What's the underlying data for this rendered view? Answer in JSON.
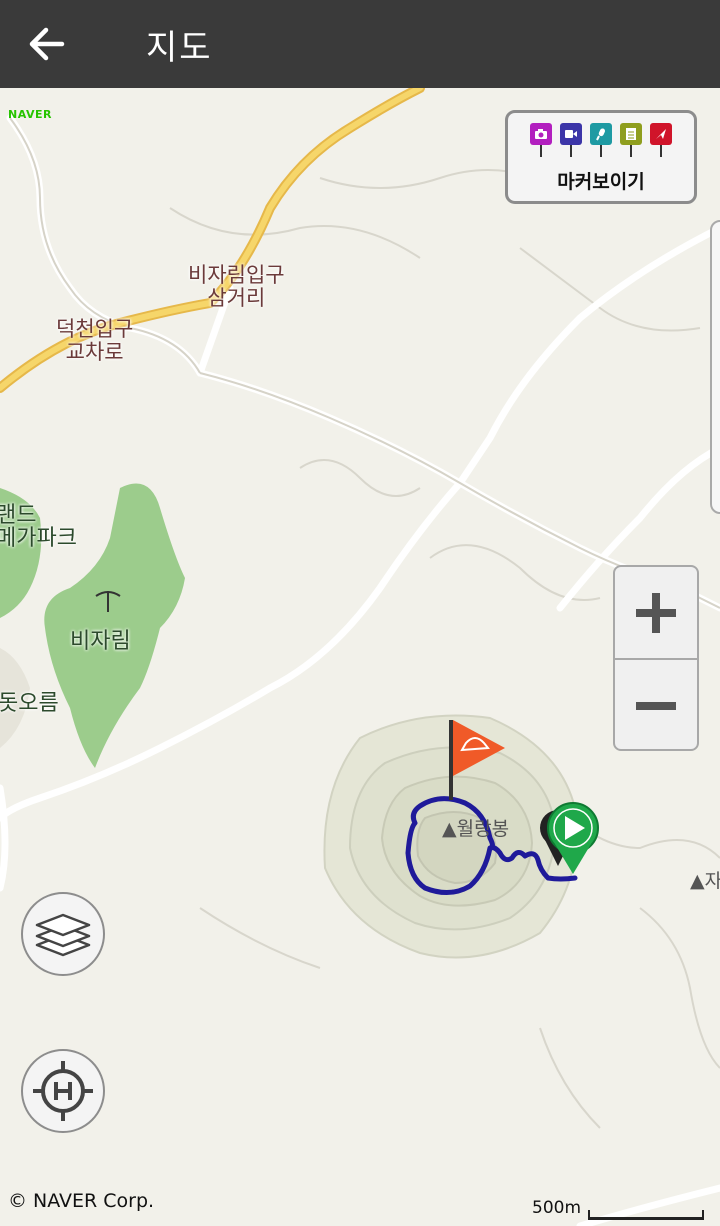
{
  "header": {
    "title": "지도",
    "back_icon": "arrow-left-icon"
  },
  "map": {
    "provider_logo": "NAVER",
    "labels": {
      "bijarim_entrance": "비자림입구\n삼거리",
      "deokcheon": "덕천입구\n교차로",
      "land_megapark": "랜드\n메가파크",
      "bijarim": "비자림",
      "dot_oreum": "돗오름",
      "peak_main": "▲월랑봉",
      "peak_right": "▲자"
    },
    "copyright": "© NAVER Corp.",
    "scale_label": "500m"
  },
  "marker_panel": {
    "label": "마커보이기",
    "icons": [
      {
        "name": "camera-icon",
        "color": "#b21fbf"
      },
      {
        "name": "video-icon",
        "color": "#3c35a8"
      },
      {
        "name": "microphone-icon",
        "color": "#1e9aa3"
      },
      {
        "name": "memo-icon",
        "color": "#8f9e1e"
      },
      {
        "name": "location-arrow-icon",
        "color": "#d0142a"
      }
    ]
  },
  "controls": {
    "zoom_in_icon": "plus-icon",
    "zoom_out_icon": "minus-icon",
    "layers_icon": "layers-icon",
    "heliport_icon": "heliport-target-icon"
  },
  "colors": {
    "track": "#1f1a9a",
    "start_marker": "#1fa84a",
    "goal_flag": "#f05a28",
    "forest": "#9ccc8c",
    "main_road": "#f4d362"
  }
}
